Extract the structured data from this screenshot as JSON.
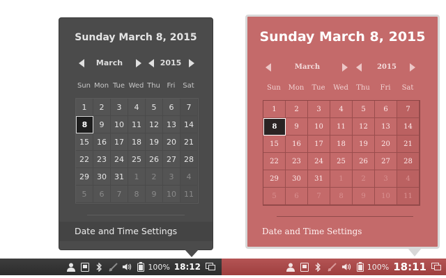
{
  "calendar_dark": {
    "title": "Sunday March  8, 2015",
    "month": "March",
    "year": "2015",
    "weekdays": [
      "Sun",
      "Mon",
      "Tue",
      "Wed",
      "Thu",
      "Fri",
      "Sat"
    ],
    "days": [
      [
        "1",
        "2",
        "3",
        "4",
        "5",
        "6",
        "7"
      ],
      [
        "8",
        "9",
        "10",
        "11",
        "12",
        "13",
        "14"
      ],
      [
        "15",
        "16",
        "17",
        "18",
        "19",
        "20",
        "21"
      ],
      [
        "22",
        "23",
        "24",
        "25",
        "26",
        "27",
        "28"
      ],
      [
        "29",
        "30",
        "31",
        "1",
        "2",
        "3",
        "4"
      ],
      [
        "5",
        "6",
        "7",
        "8",
        "9",
        "10",
        "11"
      ]
    ],
    "selected_day": "8",
    "settings_label": "Date and Time Settings"
  },
  "calendar_red": {
    "title": "Sunday March  8, 2015",
    "month": "March",
    "year": "2015",
    "weekdays": [
      "Sun",
      "Mon",
      "Tue",
      "Wed",
      "Thu",
      "Fri",
      "Sat"
    ],
    "days": [
      [
        "1",
        "2",
        "3",
        "4",
        "5",
        "6",
        "7"
      ],
      [
        "8",
        "9",
        "10",
        "11",
        "12",
        "13",
        "14"
      ],
      [
        "15",
        "16",
        "17",
        "18",
        "19",
        "20",
        "21"
      ],
      [
        "22",
        "23",
        "24",
        "25",
        "26",
        "27",
        "28"
      ],
      [
        "29",
        "30",
        "31",
        "1",
        "2",
        "3",
        "4"
      ],
      [
        "5",
        "6",
        "7",
        "8",
        "9",
        "10",
        "11"
      ]
    ],
    "selected_day": "8",
    "settings_label": "Date and Time Settings"
  },
  "taskbar_dark": {
    "battery": "100%",
    "clock": "18:12",
    "icons": [
      "user-icon",
      "screenshot-icon",
      "bluetooth-icon",
      "network-disabled-icon",
      "volume-icon",
      "battery-icon",
      "display-icon"
    ]
  },
  "taskbar_red": {
    "battery": "100%",
    "clock": "18:11",
    "icons": [
      "user-icon",
      "screenshot-icon",
      "bluetooth-icon",
      "network-disabled-icon",
      "volume-icon",
      "battery-icon",
      "display-icon"
    ]
  },
  "colors": {
    "dark_panel": "#4b4b4b",
    "red_panel": "#c46a6a",
    "red_taskbar": "#a94848",
    "dark_taskbar": "#333333"
  }
}
